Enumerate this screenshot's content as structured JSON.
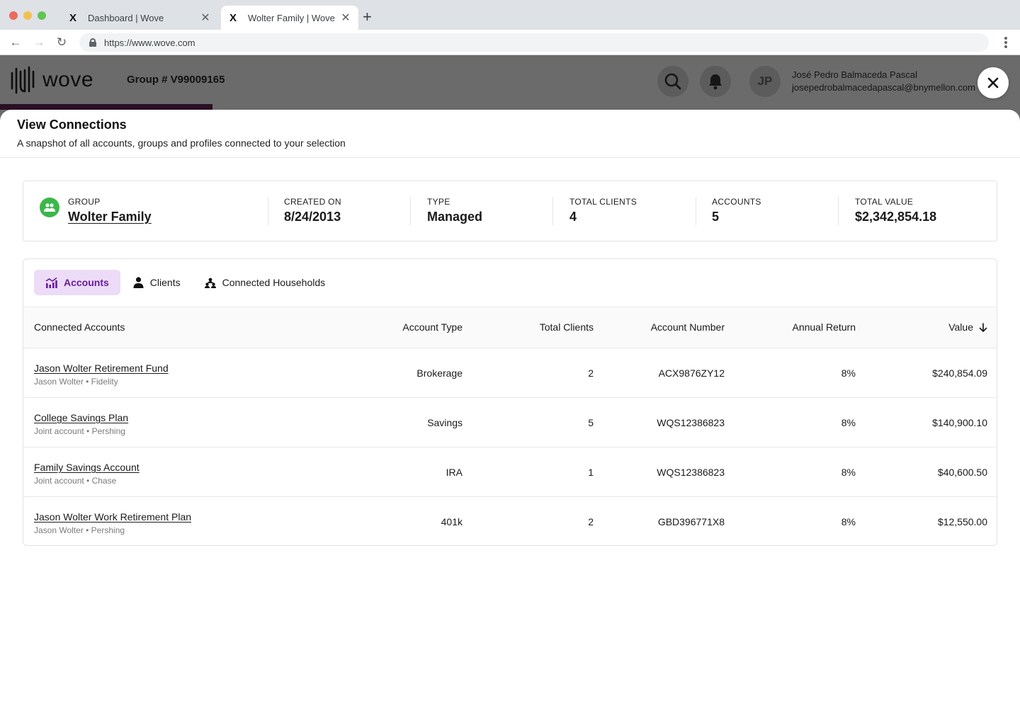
{
  "browser": {
    "tabs": [
      {
        "label": "Dashboard | Wove",
        "favicon": "X"
      },
      {
        "label": "Wolter Family | Wove",
        "favicon": "X"
      }
    ],
    "url": "https://www.wove.com"
  },
  "header": {
    "logo_text": "wove",
    "group_number": "Group # V99009165",
    "avatar_initials": "JP",
    "user_name": "José Pedro Balmaceda Pascal",
    "user_email": "josepedrobalmacedapascal@bnymellon.com"
  },
  "modal": {
    "title": "View Connections",
    "subtitle": "A snapshot of all accounts, groups and profiles connected to your selection"
  },
  "summary": {
    "group_label": "GROUP",
    "group_name": "Wolter Family",
    "created_label": "CREATED ON",
    "created_value": "8/24/2013",
    "type_label": "TYPE",
    "type_value": "Managed",
    "clients_label": "TOTAL CLIENTS",
    "clients_value": "4",
    "accounts_label": "ACCOUNTS",
    "accounts_value": "5",
    "value_label": "TOTAL VALUE",
    "value_value": "$2,342,854.18"
  },
  "tabs": [
    {
      "label": "Accounts",
      "icon": "chart-icon",
      "selected": true
    },
    {
      "label": "Clients",
      "icon": "person-icon",
      "selected": false
    },
    {
      "label": "Connected Households",
      "icon": "households-icon",
      "selected": false
    }
  ],
  "table": {
    "headers": {
      "name": "Connected Accounts",
      "type": "Account Type",
      "clients": "Total Clients",
      "number": "Account Number",
      "return": "Annual Return",
      "value": "Value"
    },
    "rows": [
      {
        "name": "Jason Wolter Retirement Fund",
        "sub": "Jason Wolter • Fidelity",
        "type": "Brokerage",
        "clients": "2",
        "number": "ACX9876ZY12",
        "return": "8%",
        "value": "$240,854.09"
      },
      {
        "name": "College Savings Plan",
        "sub": "Joint account • Pershing",
        "type": "Savings",
        "clients": "5",
        "number": "WQS12386823",
        "return": "8%",
        "value": "$140,900.10"
      },
      {
        "name": "Family Savings Account",
        "sub": "Joint account • Chase",
        "type": "IRA",
        "clients": "1",
        "number": "WQS12386823",
        "return": "8%",
        "value": "$40,600.50"
      },
      {
        "name": "Jason Wolter Work Retirement Plan",
        "sub": "Jason Wolter • Pershing",
        "type": "401k",
        "clients": "2",
        "number": "GBD396771X8",
        "return": "8%",
        "value": "$12,550.00"
      }
    ]
  },
  "colors": {
    "accent_purple": "#6a1b9a",
    "tab_selected_bg": "#ecdcf7",
    "group_green": "#3bb84a",
    "header_dim": "#6b6b6b"
  }
}
